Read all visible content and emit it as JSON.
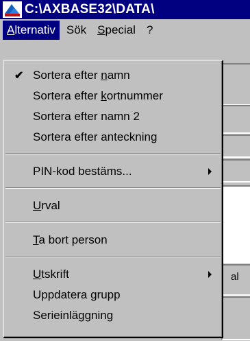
{
  "title_bar": {
    "title": "C:\\AXBASE32\\DATA\\"
  },
  "menubar": {
    "items": [
      {
        "prefix": "",
        "underline": "A",
        "suffix": "lternativ",
        "active": true
      },
      {
        "prefix": "",
        "underline": "",
        "suffix": "Sök",
        "active": false
      },
      {
        "prefix": "",
        "underline": "S",
        "suffix": "pecial",
        "active": false
      },
      {
        "prefix": "",
        "underline": "",
        "suffix": "?",
        "active": false
      }
    ]
  },
  "dropdown": {
    "items": [
      {
        "prefix": "Sortera efter ",
        "underline": "n",
        "suffix": "amn",
        "checked": true
      },
      {
        "prefix": "Sortera efter ",
        "underline": "k",
        "suffix": "ortnummer"
      },
      {
        "prefix": "Sortera efter namn 2",
        "underline": "",
        "suffix": ""
      },
      {
        "prefix": "Sortera efter anteckning",
        "underline": "",
        "suffix": ""
      },
      {
        "prefix": "PIN-kod bestäms...",
        "underline": "",
        "suffix": "",
        "submenu": true
      },
      {
        "prefix": "",
        "underline": "U",
        "suffix": "rval"
      },
      {
        "prefix": "",
        "underline": "T",
        "suffix": "a bort person"
      },
      {
        "prefix": "",
        "underline": "U",
        "suffix": "tskrift",
        "submenu": true
      },
      {
        "prefix": "Uppdatera grupp",
        "underline": "",
        "suffix": ""
      },
      {
        "prefix": "Serieinläggning",
        "underline": "",
        "suffix": ""
      }
    ]
  },
  "background": {
    "partial_label": "al"
  }
}
